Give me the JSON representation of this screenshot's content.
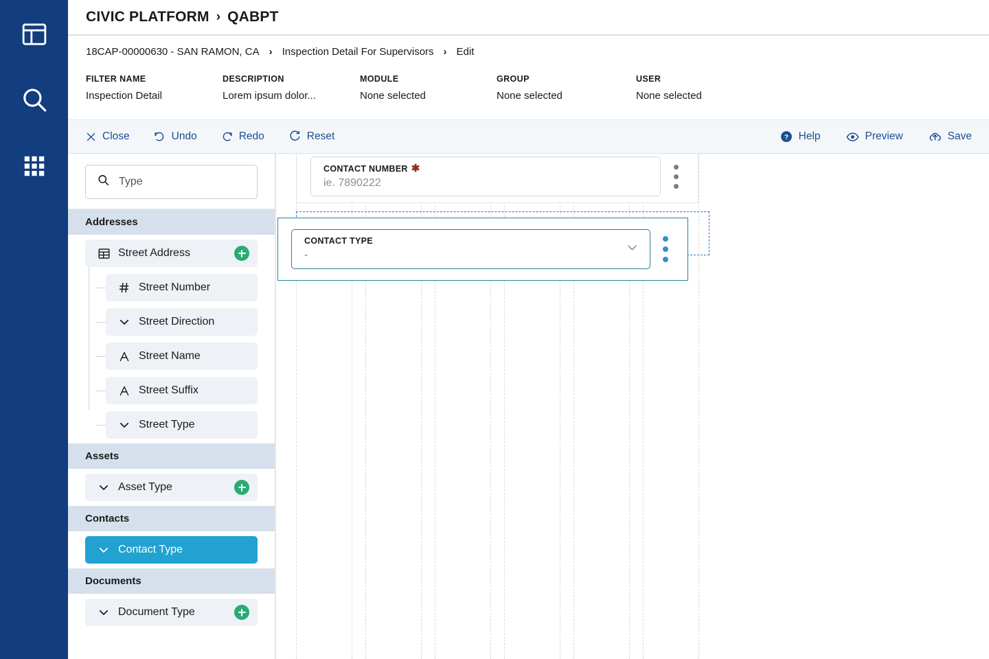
{
  "rail": {
    "items": [
      {
        "name": "dashboard-icon",
        "label": "Dashboard"
      },
      {
        "name": "search-icon",
        "label": "Search"
      },
      {
        "name": "apps-grid-icon",
        "label": "Apps"
      }
    ]
  },
  "header": {
    "app_name": "CIVIC PLATFORM",
    "separator": "›",
    "tenant": "QABPT"
  },
  "breadcrumb": {
    "separator": "›",
    "items": [
      "18CAP-00000630 - SAN RAMON, CA",
      "Inspection Detail For Supervisors",
      "Edit"
    ]
  },
  "meta": [
    {
      "key": "FILTER NAME",
      "value": "Inspection Detail"
    },
    {
      "key": "DESCRIPTION",
      "value": "Lorem ipsum dolor..."
    },
    {
      "key": "MODULE",
      "value": "None selected"
    },
    {
      "key": "GROUP",
      "value": "None selected"
    },
    {
      "key": "USER",
      "value": "None selected"
    }
  ],
  "toolbar": {
    "left": [
      {
        "name": "close-button",
        "label": "Close",
        "icon": "close-icon"
      },
      {
        "name": "undo-button",
        "label": "Undo",
        "icon": "undo-icon"
      },
      {
        "name": "redo-button",
        "label": "Redo",
        "icon": "redo-icon"
      },
      {
        "name": "reset-button",
        "label": "Reset",
        "icon": "reset-icon"
      }
    ],
    "right": [
      {
        "name": "help-button",
        "label": "Help",
        "icon": "help-circle-icon"
      },
      {
        "name": "preview-button",
        "label": "Preview",
        "icon": "eye-icon"
      },
      {
        "name": "save-button",
        "label": "Save",
        "icon": "save-cloud-icon"
      }
    ]
  },
  "sidebar": {
    "search": {
      "placeholder": "Type",
      "value": "",
      "icon": "search-icon"
    },
    "sections": [
      {
        "title": "Addresses",
        "items": [
          {
            "label": "Street Address",
            "icon": "table-icon",
            "child": false,
            "add": true,
            "selected": false
          },
          {
            "label": "Street Number",
            "icon": "hash-icon",
            "child": true,
            "add": false,
            "selected": false
          },
          {
            "label": "Street Direction",
            "icon": "chevron-down-icon",
            "child": true,
            "add": false,
            "selected": false
          },
          {
            "label": "Street Name",
            "icon": "text-a-icon",
            "child": true,
            "add": false,
            "selected": false
          },
          {
            "label": "Street Suffix",
            "icon": "text-a-icon",
            "child": true,
            "add": false,
            "selected": false
          },
          {
            "label": "Street Type",
            "icon": "chevron-down-icon",
            "child": true,
            "add": false,
            "selected": false
          }
        ]
      },
      {
        "title": "Assets",
        "items": [
          {
            "label": "Asset Type",
            "icon": "chevron-down-icon",
            "child": false,
            "add": true,
            "selected": false
          }
        ]
      },
      {
        "title": "Contacts",
        "items": [
          {
            "label": "Contact Type",
            "icon": "chevron-down-icon",
            "child": false,
            "add": false,
            "selected": true
          }
        ]
      },
      {
        "title": "Documents",
        "items": [
          {
            "label": "Document Type",
            "icon": "chevron-down-icon",
            "child": false,
            "add": true,
            "selected": false
          }
        ]
      }
    ]
  },
  "canvas": {
    "fields": [
      {
        "label": "CONTACT NUMBER",
        "required": true,
        "value": "ie. 7890222",
        "type": "text",
        "selected": false,
        "menu_icon": "kebab-menu-icon"
      },
      {
        "label": "CONTACT TYPE",
        "required": false,
        "value": "-",
        "type": "dropdown",
        "selected": true,
        "menu_icon": "kebab-menu-icon"
      }
    ],
    "grid_columns": 6
  },
  "colors": {
    "rail_bg": "#123d7e",
    "accent_link": "#1b4e92",
    "selected_row": "#22a2d0",
    "add_green": "#2aab73",
    "selected_outline": "#2a8295",
    "drop_outline": "#2f6fc4",
    "required_star": "#8d2b26",
    "section_header": "#d5e0ec"
  }
}
